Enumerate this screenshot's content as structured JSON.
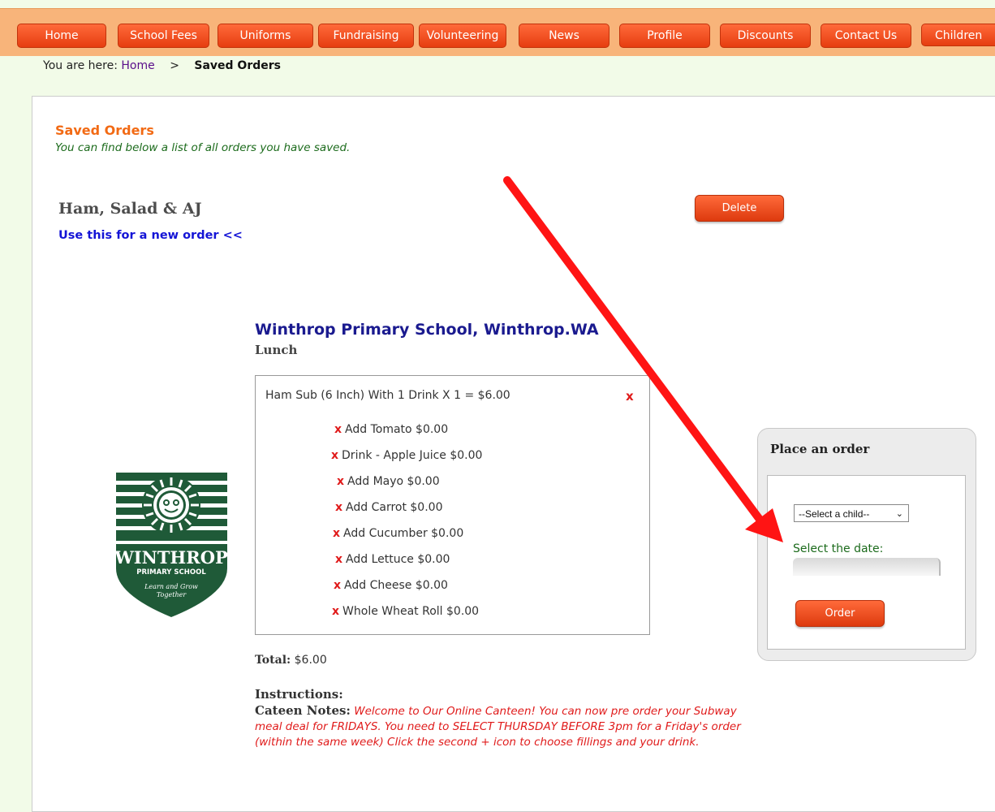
{
  "nav": {
    "items": [
      {
        "label": "Home"
      },
      {
        "label": "School Fees"
      },
      {
        "label": "Uniforms"
      },
      {
        "label": "Fundraising"
      },
      {
        "label": "Volunteering"
      },
      {
        "label": "News"
      },
      {
        "label": "Profile"
      },
      {
        "label": "Discounts"
      },
      {
        "label": "Contact Us"
      },
      {
        "label": "Children"
      }
    ]
  },
  "breadcrumb": {
    "prefix": "You are here:",
    "home": "Home",
    "separator": ">",
    "current": "Saved Orders"
  },
  "section": {
    "title": "Saved Orders",
    "subtitle": "You can find below a list of all orders you have saved."
  },
  "saved_order": {
    "name": "Ham, Salad & AJ",
    "reuse_link": "Use this for a new order <<",
    "delete_label": "Delete",
    "school": "Winthrop Primary School, Winthrop.WA",
    "meal": "Lunch",
    "main_item": "Ham Sub (6 Inch) With 1 Drink X 1 = $6.00",
    "remove_glyph": "x",
    "extras": [
      "Add Tomato $0.00",
      "Drink - Apple Juice $0.00",
      "Add Mayo $0.00",
      "Add Carrot $0.00",
      "Add Cucumber $0.00",
      "Add Lettuce $0.00",
      "Add Cheese $0.00",
      "Whole Wheat Roll $0.00"
    ],
    "total_label": "Total:",
    "total_value": "$6.00",
    "instructions_label": "Instructions:",
    "notes_label": "Cateen Notes:",
    "notes_text": "Welcome to Our Online Canteen! You can now pre order your Subway meal deal for FRIDAYS. You need to SELECT THURSDAY BEFORE 3pm for a Friday's order (within the same week) Click the second + icon to choose fillings and your drink."
  },
  "logo": {
    "name": "WINTHROP",
    "line2": "PRIMARY SCHOOL",
    "motto": "Learn and Grow Together",
    "color": "#1f5a38"
  },
  "place_order": {
    "title": "Place an order",
    "child_select": "--Select a child--",
    "date_label": "Select the date:",
    "date_value": "",
    "order_label": "Order"
  },
  "colors": {
    "accent": "#e8451a",
    "nav_bar": "#f8b47a",
    "arrow": "#ff1414"
  }
}
